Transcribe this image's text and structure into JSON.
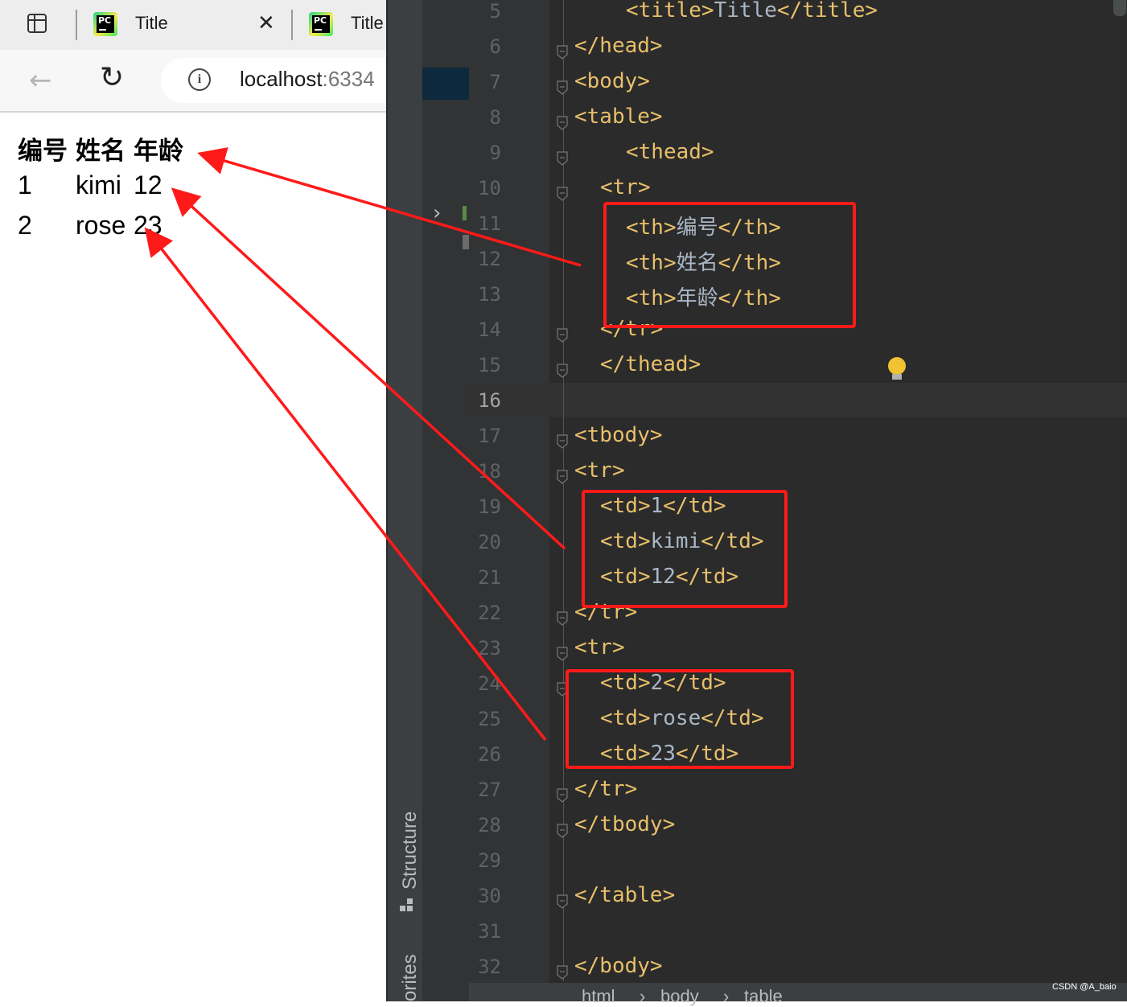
{
  "browser": {
    "tabs": [
      {
        "title": "Title",
        "close": "✕"
      },
      {
        "title": "Title"
      }
    ],
    "address": {
      "host": "localhost",
      "port_partial": ":6334"
    },
    "page_table": {
      "headers": [
        "编号",
        "姓名",
        "年龄"
      ],
      "rows": [
        [
          "1",
          "kimi",
          "12"
        ],
        [
          "2",
          "rose",
          "23"
        ]
      ]
    }
  },
  "ide": {
    "side_labels": {
      "structure": "Structure",
      "favorites": "orites"
    },
    "line_numbers": [
      "5",
      "6",
      "7",
      "8",
      "9",
      "10",
      "11",
      "12",
      "13",
      "14",
      "15",
      "16",
      "17",
      "18",
      "19",
      "20",
      "21",
      "22",
      "23",
      "24",
      "25",
      "26",
      "27",
      "28",
      "29",
      "30",
      "31",
      "32"
    ],
    "active_line": "16",
    "code": {
      "l5": {
        "open": "<title>",
        "text": "Title",
        "close": "</title>"
      },
      "l6": "</head>",
      "l7": "<body>",
      "l8": "<table>",
      "l9": "<thead>",
      "l10": "<tr>",
      "l11": {
        "open": "<th>",
        "text": "编号",
        "close": "</th>"
      },
      "l12": {
        "open": "<th>",
        "text": "姓名",
        "close": "</th>"
      },
      "l13": {
        "open": "<th>",
        "text": "年龄",
        "close": "</th>"
      },
      "l14": "</tr>",
      "l15": "</thead>",
      "l17": "<tbody>",
      "l18": "<tr>",
      "l19": {
        "open": "<td>",
        "text": "1",
        "close": "</td>"
      },
      "l20": {
        "open": "<td>",
        "text": "kimi",
        "close": "</td>"
      },
      "l21": {
        "open": "<td>",
        "text": "12",
        "close": "</td>"
      },
      "l22": "</tr>",
      "l23": "<tr>",
      "l24": {
        "open": "<td>",
        "text": "2",
        "close": "</td>"
      },
      "l25": {
        "open": "<td>",
        "text": "rose",
        "close": "</td>"
      },
      "l26": {
        "open": "<td>",
        "text": "23",
        "close": "</td>"
      },
      "l27": "</tr>",
      "l28": "</tbody>",
      "l30": "</table>",
      "l32": "</body>"
    },
    "breadcrumbs": [
      "html",
      "body",
      "table"
    ],
    "breadcrumb_sep": "›"
  },
  "watermark": "CSDN @A_baio",
  "colors": {
    "annotation_red": "#ff1a1a",
    "tag": "#e8bf6a",
    "text": "#a9b7c6",
    "editor_bg": "#2b2b2b"
  },
  "icons": [
    "sidebar-toggle-icon",
    "pycharm-icon",
    "close-icon",
    "back-arrow-icon",
    "reload-icon",
    "info-icon",
    "structure-icon",
    "lightbulb-icon",
    "fold-marker-icon",
    "chevron-right-icon"
  ]
}
